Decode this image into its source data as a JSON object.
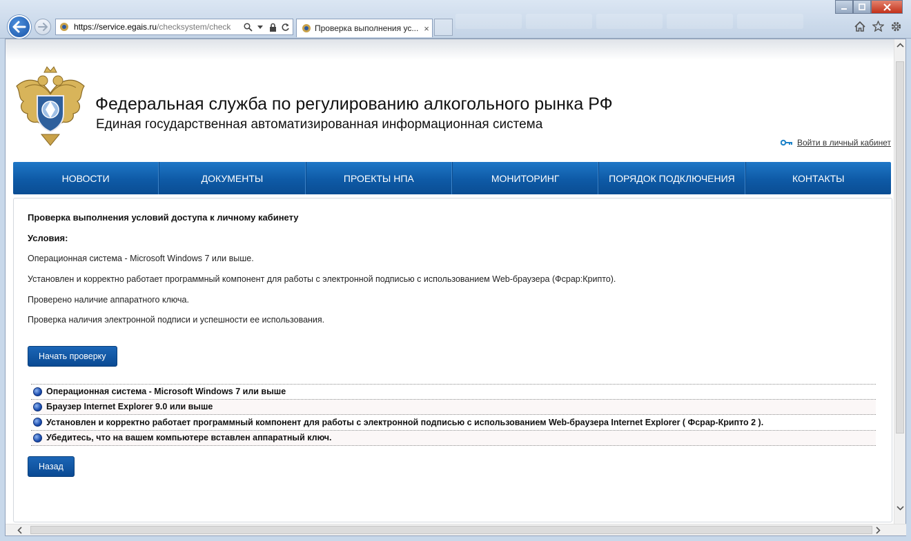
{
  "browser": {
    "url_host": "https://service.egais.ru",
    "url_path": "/checksystem/check",
    "tab_title": "Проверка выполнения ус...",
    "tab_close": "×"
  },
  "site": {
    "title": "Федеральная служба по регулированию алкогольного рынка РФ",
    "subtitle": "Единая государственная автоматизированная информационная система",
    "login_label": "Войти в личный кабинет"
  },
  "nav": {
    "items": [
      {
        "label": "НОВОСТИ"
      },
      {
        "label": "ДОКУМЕНТЫ"
      },
      {
        "label": "ПРОЕКТЫ НПА"
      },
      {
        "label": "МОНИТОРИНГ"
      },
      {
        "label": "ПОРЯДОК ПОДКЛЮЧЕНИЯ"
      },
      {
        "label": "КОНТАКТЫ"
      }
    ]
  },
  "main": {
    "heading": "Проверка выполнения условий доступа к личному кабинету",
    "conditions_label": "Условия:",
    "conditions": [
      "Операционная система - Microsoft Windows 7 или выше.",
      "Установлен и корректно работает программный компонент для работы с электронной подписью с использованием Web-браузера (Фсрар:Крипто).",
      "Проверено наличие аппаратного ключа.",
      "Проверка наличия электронной подписи и успешности ее использования."
    ],
    "start_button": "Начать проверку",
    "checks": [
      "Операционная система - Microsoft Windows 7 или выше",
      "Браузер Internet Explorer 9.0 или выше",
      "Установлен и корректно работает программный компонент для работы с электронной подписью с использованием Web-браузера Internet Explorer ( Фсрар-Крипто 2 ).",
      "Убедитесь, что на вашем компьютере вставлен аппаратный ключ."
    ],
    "back_button": "Назад"
  },
  "colors": {
    "nav_blue": "#0e5aa6",
    "button_blue": "#0a4a93",
    "status_dot": "#1d4fb0"
  }
}
